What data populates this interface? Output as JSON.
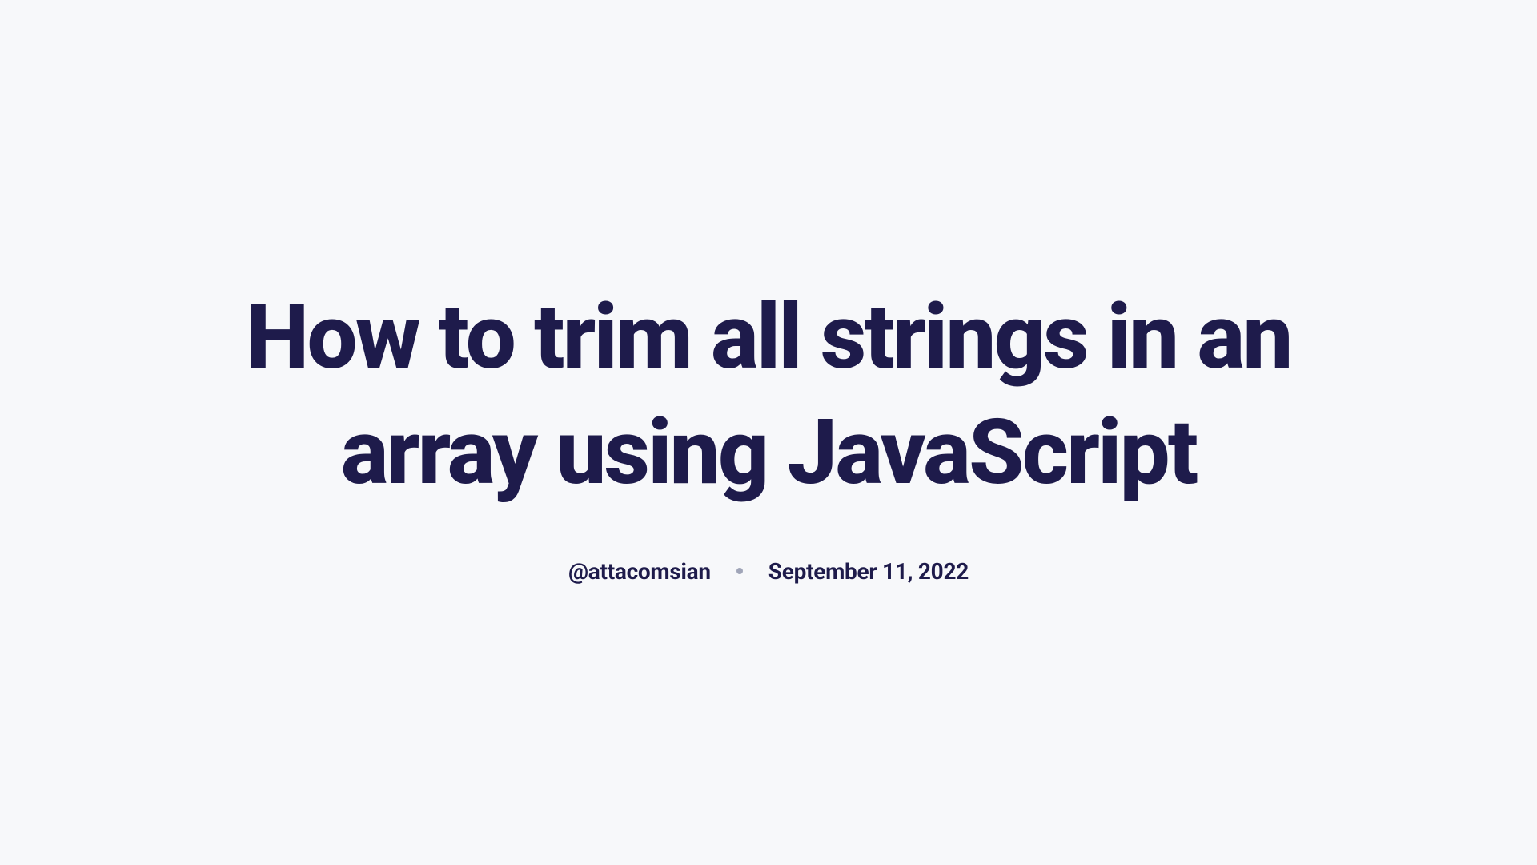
{
  "title": "How to trim all strings in an array using JavaScript",
  "author": "@attacomsian",
  "date": "September 11, 2022"
}
